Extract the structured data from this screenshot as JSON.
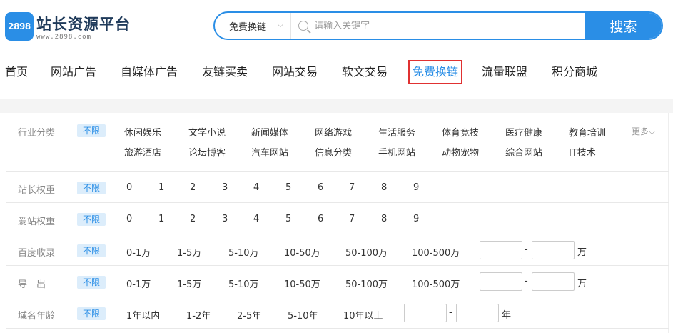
{
  "header": {
    "logo_badge": "2898",
    "logo_title": "站长资源平台",
    "logo_sub": "www.2898.com"
  },
  "search": {
    "category": "免费换链",
    "placeholder": "请输入关键字",
    "button": "搜索"
  },
  "nav": [
    {
      "label": "首页"
    },
    {
      "label": "网站广告"
    },
    {
      "label": "自媒体广告"
    },
    {
      "label": "友链买卖"
    },
    {
      "label": "网站交易"
    },
    {
      "label": "软文交易"
    },
    {
      "label": "免费换链",
      "active": true
    },
    {
      "label": "流量联盟"
    },
    {
      "label": "积分商城"
    }
  ],
  "filters": {
    "unlimited": "不限",
    "more": "更多",
    "industry": {
      "label": "行业分类",
      "row1": [
        "休闲娱乐",
        "文学小说",
        "新闻媒体",
        "网络游戏",
        "生活服务",
        "体育竞技",
        "医疗健康",
        "教育培训"
      ],
      "row2": [
        "旅游酒店",
        "论坛博客",
        "汽车网站",
        "信息分类",
        "手机网站",
        "动物宠物",
        "综合网站",
        "IT技术"
      ]
    },
    "zz_weight": {
      "label": "站长权重",
      "options": [
        "0",
        "1",
        "2",
        "3",
        "4",
        "5",
        "6",
        "7",
        "8",
        "9"
      ]
    },
    "az_weight": {
      "label": "爱站权重",
      "options": [
        "0",
        "1",
        "2",
        "3",
        "4",
        "5",
        "6",
        "7",
        "8",
        "9"
      ]
    },
    "baidu_index": {
      "label": "百度收录",
      "options": [
        "0-1万",
        "1-5万",
        "5-10万",
        "10-50万",
        "50-100万",
        "100-500万"
      ],
      "dash": "-",
      "unit": "万"
    },
    "outlinks": {
      "label": "导　出",
      "options": [
        "0-1万",
        "1-5万",
        "5-10万",
        "10-50万",
        "50-100万",
        "100-500万"
      ],
      "dash": "-",
      "unit": "万"
    },
    "domain_age": {
      "label": "域名年龄",
      "options": [
        "1年以内",
        "1-2年",
        "2-5年",
        "5-10年",
        "10年以上"
      ],
      "dash": "-",
      "unit": "年"
    }
  }
}
